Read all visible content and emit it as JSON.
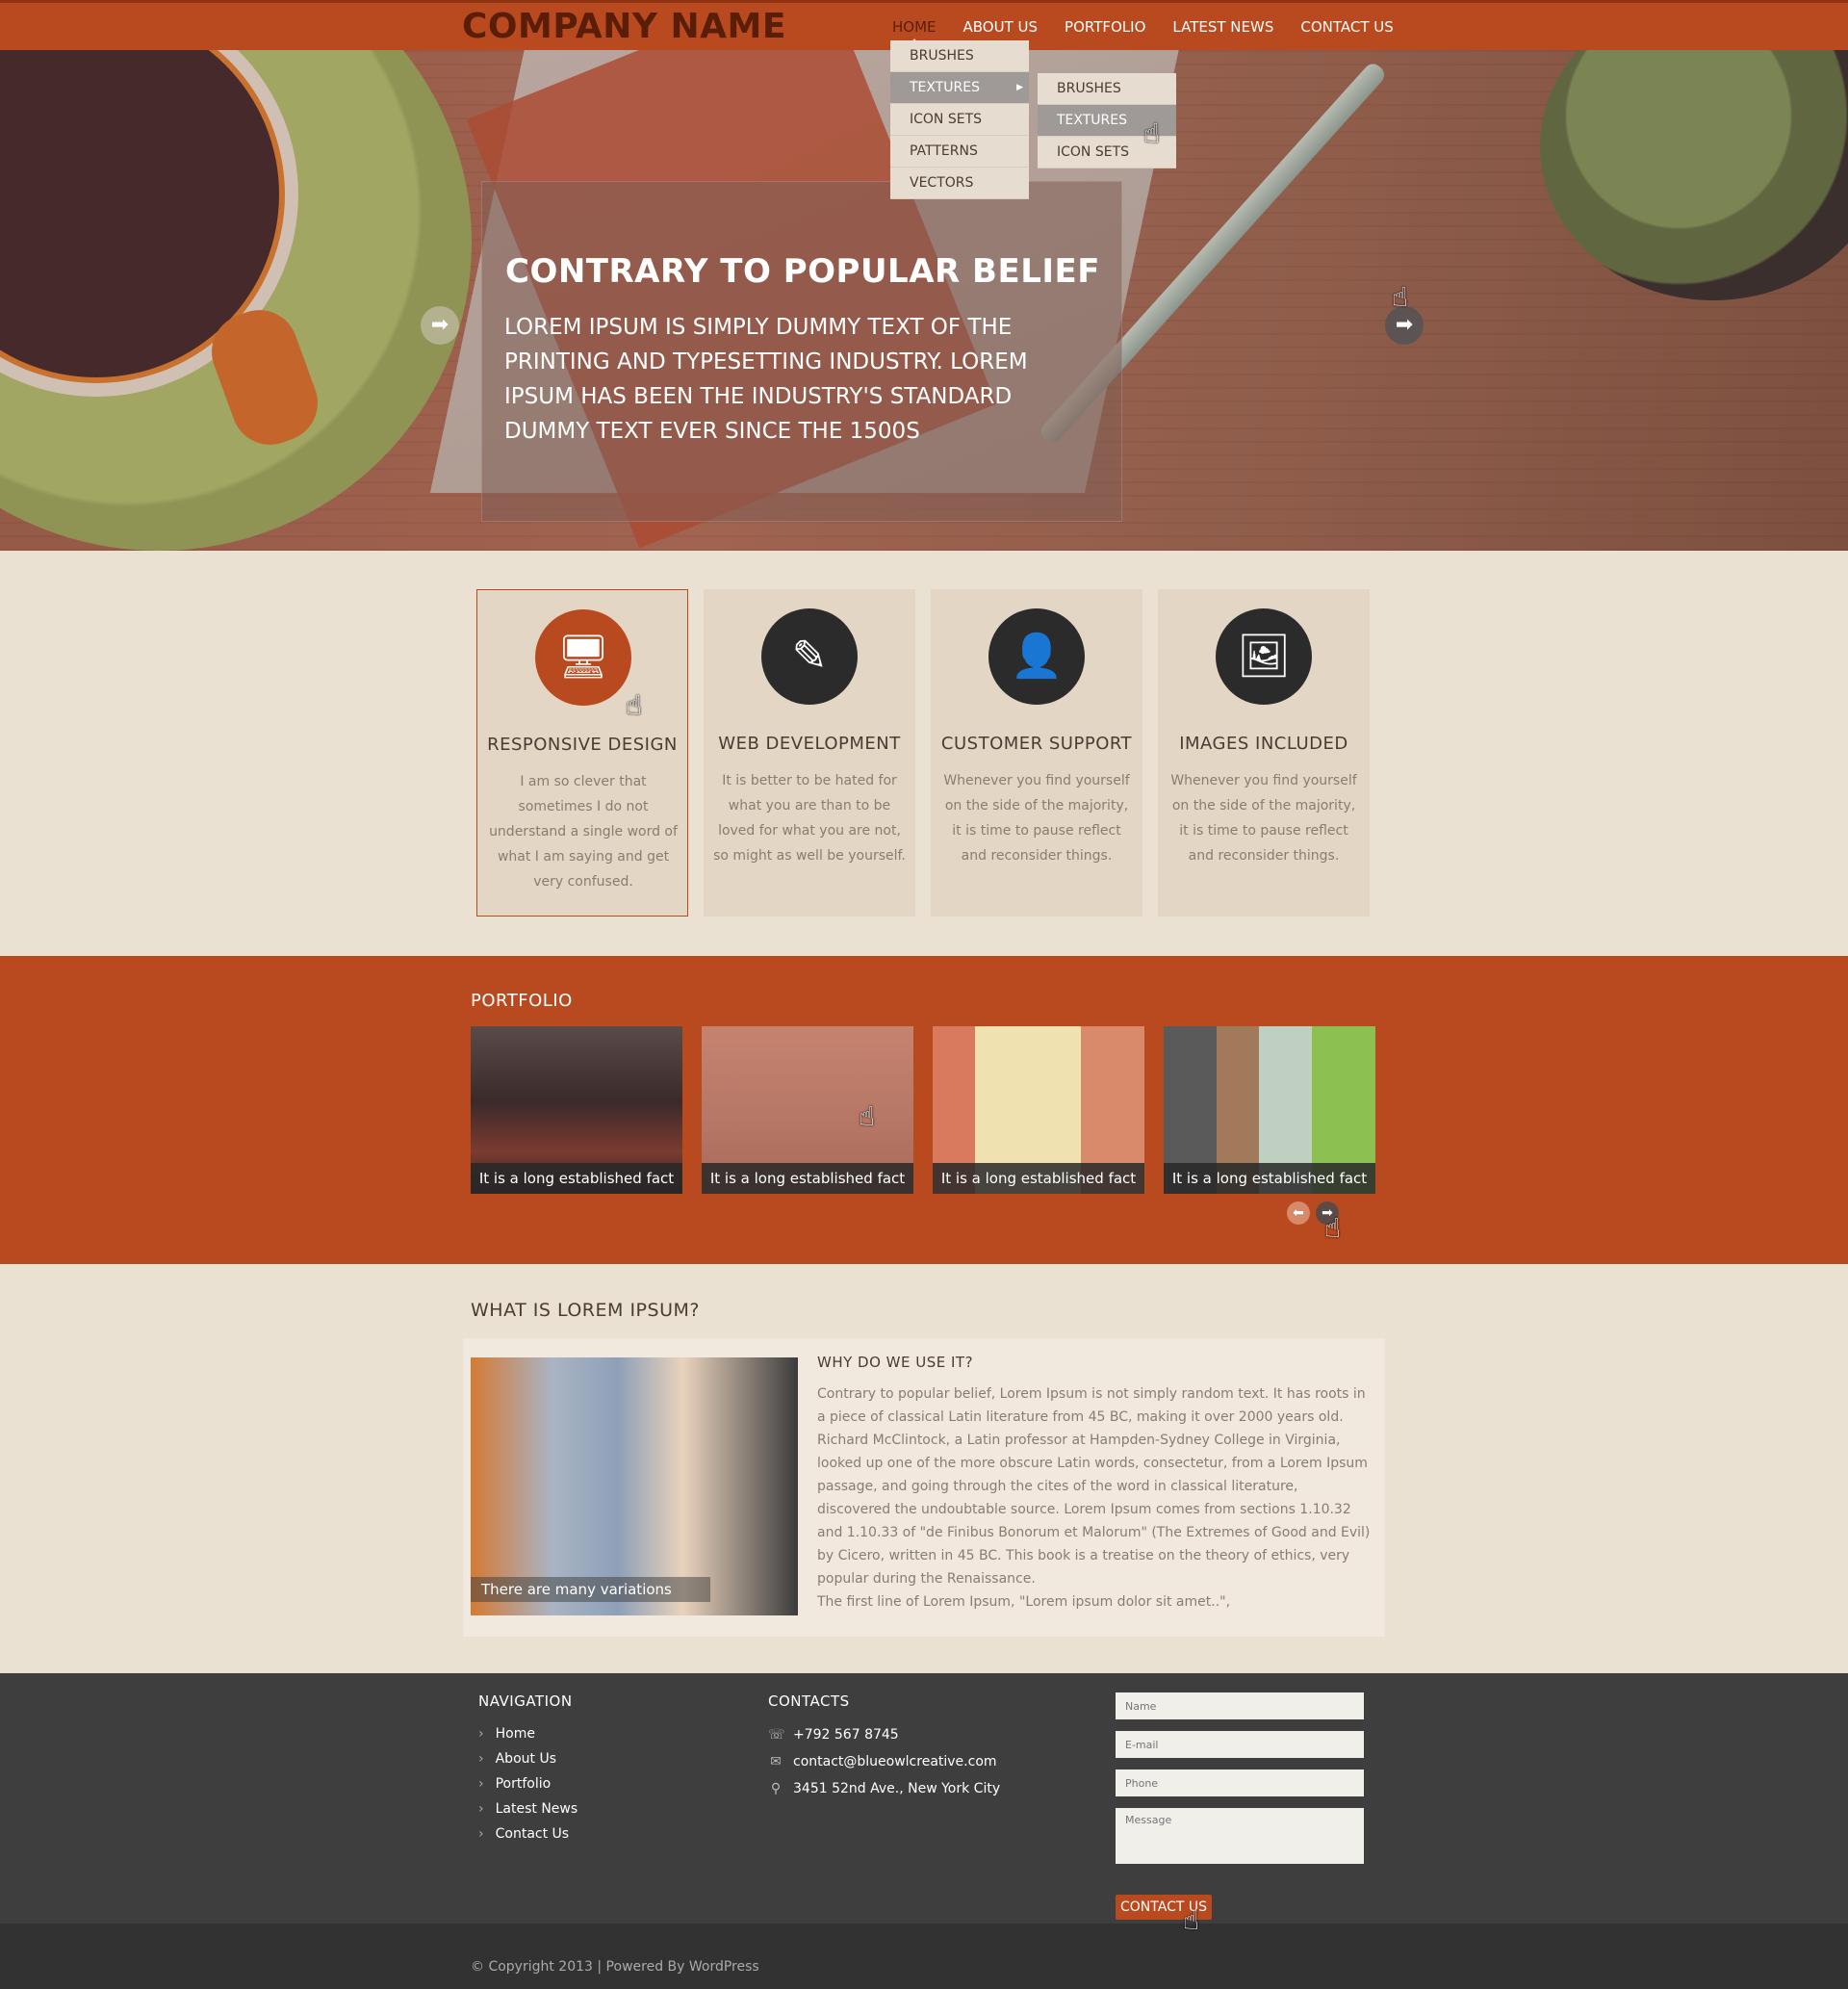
{
  "header": {
    "logo": "COMPANY NAME",
    "nav": [
      "HOME",
      "ABOUT US",
      "PORTFOLIO",
      "LATEST NEWS",
      "CONTACT US"
    ],
    "active": "HOME",
    "dropdown": [
      "BRUSHES",
      "TEXTURES",
      "ICON SETS",
      "PATTERNS",
      "VECTORS"
    ],
    "submenu": [
      "BRUSHES",
      "TEXTURES",
      "ICON SETS"
    ]
  },
  "hero": {
    "title": "CONTRARY TO POPULAR BELIEF",
    "text": "LOREM IPSUM IS SIMPLY DUMMY TEXT OF THE PRINTING AND TYPESETTING INDUSTRY. LOREM IPSUM HAS BEEN THE INDUSTRY'S STANDARD DUMMY TEXT EVER SINCE THE 1500S",
    "prev_icon": "arrow-left-icon",
    "next_icon": "arrow-right-icon"
  },
  "features": [
    {
      "title": "RESPONSIVE DESIGN",
      "text": "I am so clever that sometimes I do not  understand a single word of what I am saying and get very confused.",
      "icon": "monitor-icon"
    },
    {
      "title": "WEB DEVELOPMENT",
      "text": "It is better to be hated for what you are than to be loved for what you are not, so might as well be yourself.",
      "icon": "edit-icon"
    },
    {
      "title": "CUSTOMER SUPPORT",
      "text": "Whenever you find yourself on the side of the majority, it is time to pause reflect and reconsider things.",
      "icon": "user-icon"
    },
    {
      "title": "IMAGES INCLUDED",
      "text": "Whenever you find yourself on the side of the majority, it is time to pause reflect and reconsider things.",
      "icon": "images-icon"
    }
  ],
  "portfolio": {
    "title": "PORTFOLIO",
    "items": [
      "It is a long established fact",
      "It is a long established fact",
      "It is a long established fact",
      "It is a long established fact"
    ]
  },
  "about": {
    "title": "WHAT IS LOREM IPSUM?",
    "image_caption": "There are many variations",
    "subtitle": "WHY DO WE USE IT?",
    "text": "Contrary to popular belief, Lorem Ipsum is not simply random text. It has roots in a piece of classical Latin literature from 45 BC, making it over 2000 years old. Richard McClintock, a Latin professor at Hampden-Sydney College in Virginia, looked up one of the more obscure Latin words, consectetur, from a Lorem Ipsum passage, and going through the cites of the word in classical literature, discovered the undoubtable source. Lorem Ipsum comes from sections 1.10.32 and 1.10.33 of \"de Finibus Bonorum et Malorum\" (The Extremes of Good and Evil) by Cicero, written in 45 BC. This book is a treatise on the theory of ethics, very popular during the Renaissance.",
    "text2": "The first line of Lorem Ipsum, \"Lorem ipsum dolor sit amet..\","
  },
  "footer": {
    "nav_title": "NAVIGATION",
    "nav": [
      "Home",
      "About Us",
      "Portfolio",
      "Latest News",
      "Contact Us"
    ],
    "contacts_title": "CONTACTS",
    "phone": "+792 567 8745",
    "email": "contact@blueowlcreative.com",
    "address": "3451 52nd Ave., New York City",
    "form": {
      "name_placeholder": "Name",
      "email_placeholder": "E-mail",
      "phone_placeholder": "Phone",
      "message_placeholder": "Message",
      "submit": "CONTACT US"
    },
    "copyright": "© Copyright 2013  | Powered By WordPress"
  },
  "colors": {
    "accent": "#b94a1f",
    "dark": "#3e3e3e",
    "background": "#ebe1d3"
  }
}
